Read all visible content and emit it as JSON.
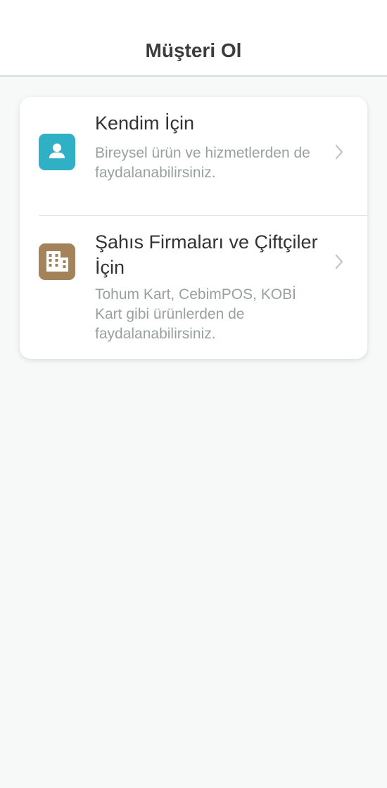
{
  "header": {
    "title": "Müşteri Ol"
  },
  "options": [
    {
      "title": "Kendim İçin",
      "description": "Bireysel ürün ve hizmetlerden de faydalanabilirsiniz.",
      "icon": "person-icon",
      "icon_color": "#2fb0c5"
    },
    {
      "title": "Şahıs Firmaları ve Çiftçiler İçin",
      "description": "Tohum Kart, CebimPOS, KOBİ Kart gibi ürünlerden de faydalanabilirsiniz.",
      "icon": "building-icon",
      "icon_color": "#a4835a"
    }
  ],
  "colors": {
    "background": "#f6f9f8",
    "title_text": "#333333",
    "description_text": "#99a0a0",
    "chevron": "#c2c7c7"
  }
}
